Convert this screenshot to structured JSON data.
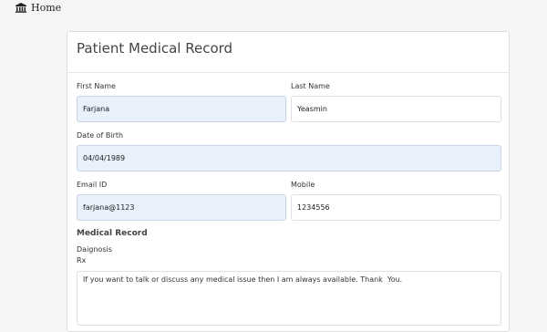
{
  "nav": {
    "home_label": "Home",
    "home_icon": "bank-icon"
  },
  "form": {
    "title": "Patient Medical Record",
    "first_name": {
      "label": "First Name",
      "value": "Farjana"
    },
    "last_name": {
      "label": "Last Name",
      "value": "Yeasmin"
    },
    "dob": {
      "label": "Date of Birth",
      "value": "04/04/1989"
    },
    "email": {
      "label": "Email ID",
      "value": "farjana@1123"
    },
    "mobile": {
      "label": "Mobile",
      "value": "1234556"
    },
    "medical_record": {
      "heading": "Medical Record",
      "diagnosis_label": "Daignosis",
      "rx_label": "Rx",
      "rx_value": "If you want to talk or discuss any medical issue then I am always available. Thank  You."
    }
  },
  "colors": {
    "filled_field_bg": "#e8f0fb",
    "page_bg": "#f5f5f5"
  }
}
